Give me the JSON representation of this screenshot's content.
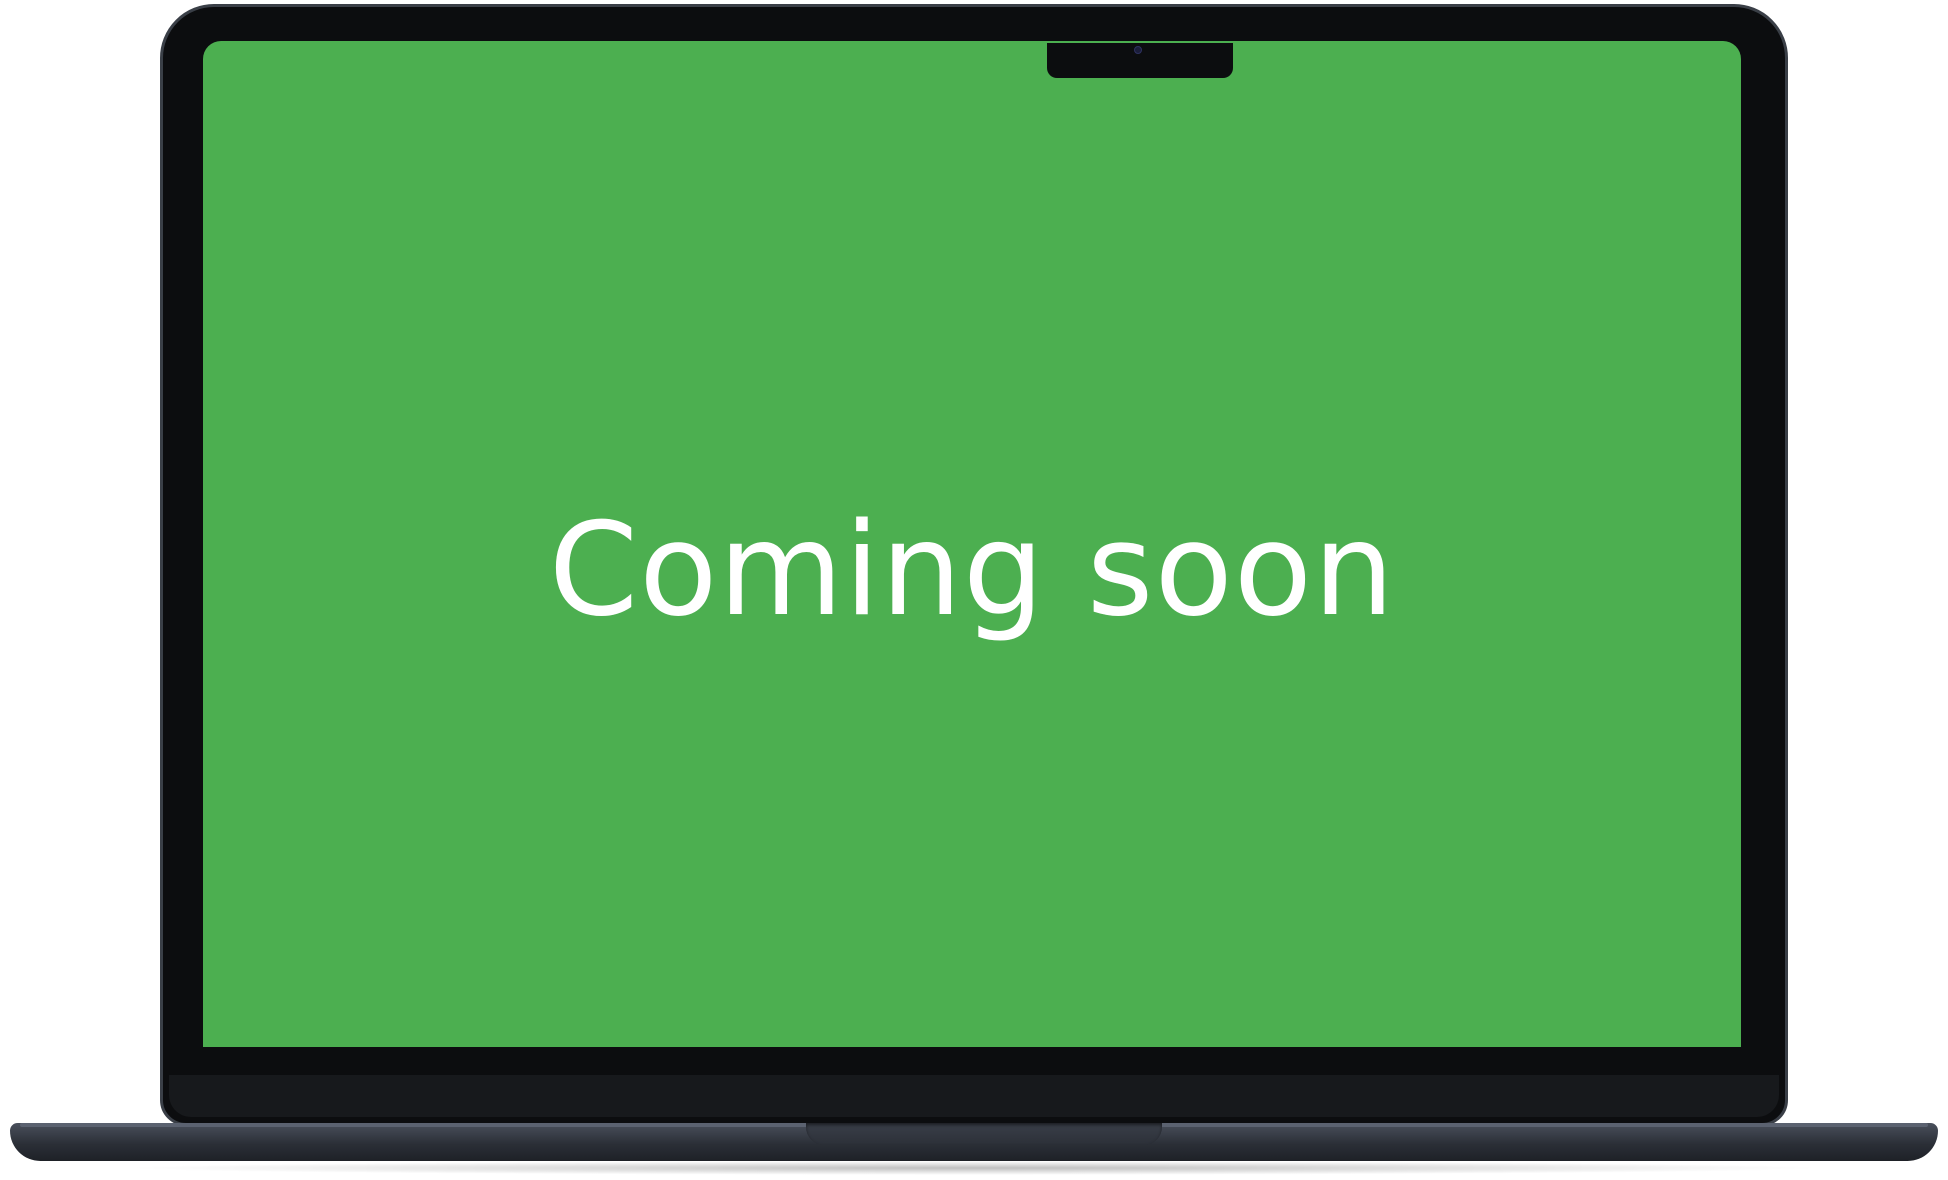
{
  "device": {
    "type": "laptop",
    "screen": {
      "message": "Coming soon",
      "background_color": "#4caf50",
      "text_color": "#ffffff"
    },
    "bezel_color": "#0c0d0f",
    "base_color": "#2b2f37"
  }
}
